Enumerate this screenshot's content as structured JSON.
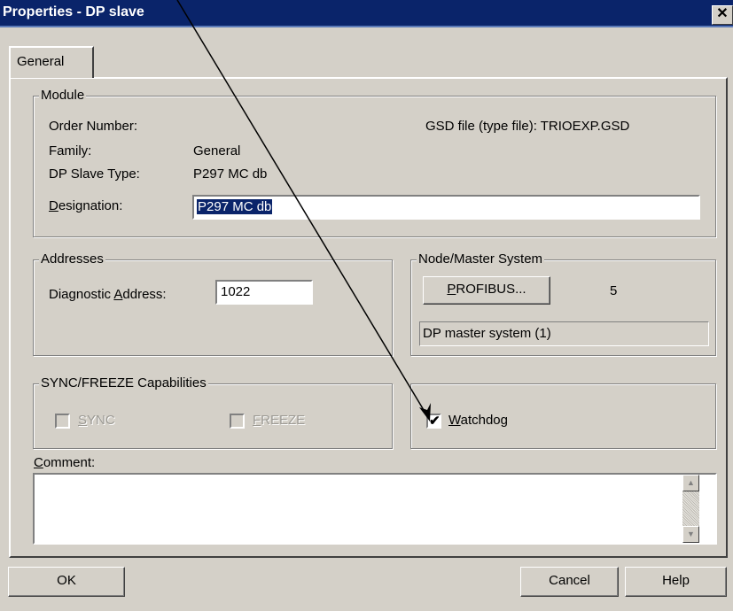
{
  "window": {
    "title": "Properties - DP slave",
    "close_glyph": "✕"
  },
  "tabs": [
    "General"
  ],
  "module": {
    "legend": "Module",
    "order_number_label": "Order Number:",
    "order_number_value": "",
    "gsd_file_text": "GSD file (type file): TRIOEXP.GSD",
    "family_label": "Family:",
    "family_value": "General",
    "dp_slave_type_label": "DP Slave Type:",
    "dp_slave_type_value": "P297 MC db",
    "designation_label_prefix": "D",
    "designation_label_rest": "esignation:",
    "designation_value": "P297 MC db"
  },
  "addresses": {
    "legend": "Addresses",
    "diag_label_a": "Diagnostic ",
    "diag_label_u": "A",
    "diag_label_b": "ddress:",
    "diag_value": "1022"
  },
  "node_master": {
    "legend": "Node/Master System",
    "profibus_button_u": "P",
    "profibus_button_rest": "ROFIBUS...",
    "node_number": "5",
    "master_system": "DP master system (1)"
  },
  "sync_freeze": {
    "legend": "SYNC/FREEZE Capabilities",
    "sync_u": "S",
    "sync_rest": "YNC",
    "sync_checked": false,
    "freeze_u": "F",
    "freeze_rest": "REEZE",
    "freeze_checked": false
  },
  "watchdog": {
    "label_u": "W",
    "label_rest": "atchdog",
    "checked": true,
    "check_glyph": "✔"
  },
  "comment": {
    "label_u": "C",
    "label_rest": "omment:",
    "value": ""
  },
  "buttons": {
    "ok": "OK",
    "cancel": "Cancel",
    "help": "Help"
  },
  "icons": {
    "scroll_up": "▲",
    "scroll_down": "▼"
  },
  "colors": {
    "title_bar": "#0a246a",
    "dialog_face": "#d4d0c8",
    "selection": "#0a246a"
  }
}
